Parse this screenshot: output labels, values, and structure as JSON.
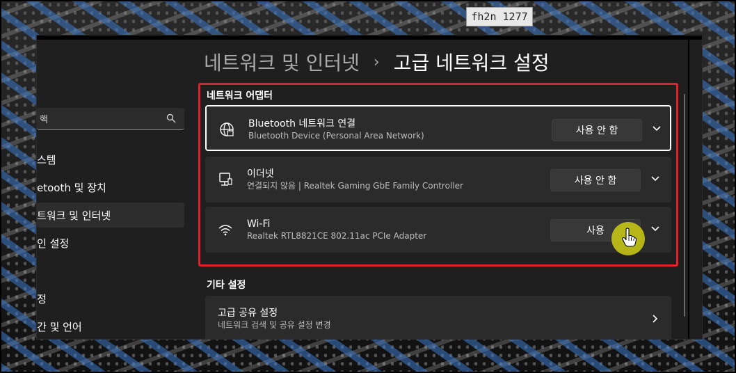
{
  "background": {
    "label": "fh2n 1277"
  },
  "sidebar": {
    "search_text": "핵",
    "items": [
      {
        "label": "스템"
      },
      {
        "label": "etooth 및 장치"
      },
      {
        "label": "트워크 및 인터넷",
        "active": true
      },
      {
        "label": "인 설정"
      },
      {
        "label": "정"
      },
      {
        "label": "간 및 언어"
      }
    ]
  },
  "header": {
    "parent": "네트워크 및 인터넷",
    "separator": "›",
    "current": "고급 네트워크 설정"
  },
  "adapters": {
    "section_title": "네트워크 어댑터",
    "items": [
      {
        "title": "Bluetooth 네트워크 연결",
        "subtitle": "Bluetooth Device (Personal Area Network)",
        "button": "사용 안 함",
        "icon": "globe-icon"
      },
      {
        "title": "이더넷",
        "subtitle": "연결되지 않음 | Realtek Gaming GbE Family Controller",
        "button": "사용 안 함",
        "icon": "ethernet-icon"
      },
      {
        "title": "Wi-Fi",
        "subtitle": "Realtek RTL8821CE 802.11ac PCIe Adapter",
        "button": "사용",
        "icon": "wifi-icon"
      }
    ]
  },
  "other": {
    "section_title": "기타 설정",
    "items": [
      {
        "title": "고급 공유 설정",
        "subtitle": "네트워크 검색 및 공유 설정 변경"
      }
    ]
  },
  "colors": {
    "highlight": "#e0202a",
    "cursor_halo": "#c8c814"
  }
}
